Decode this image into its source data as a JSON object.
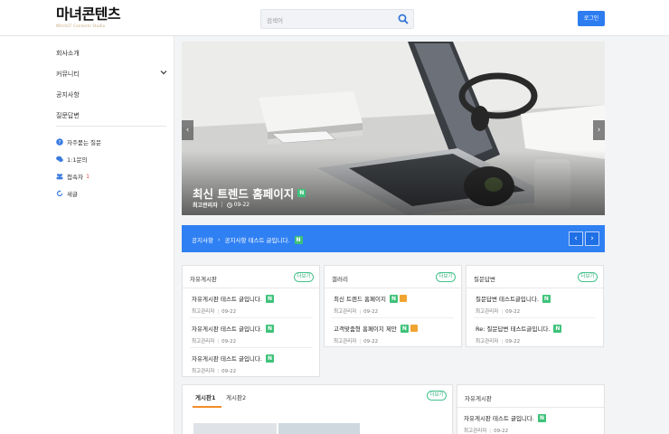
{
  "header": {
    "logo_title": "마녀콘텐츠",
    "logo_subtitle": "WitchCF Contents Studio",
    "search_placeholder": "검색어",
    "login_label": "로그인"
  },
  "sidebar": {
    "menu": [
      "회사소개",
      "커뮤니티",
      "공지사항",
      "질문답변"
    ],
    "sub": [
      {
        "label": "자주묻는 질문",
        "icon": "question-circle-icon"
      },
      {
        "label": "1:1문의",
        "icon": "chat-bubbles-icon"
      },
      {
        "label": "접속자",
        "count": "1",
        "icon": "users-icon"
      },
      {
        "label": "새글",
        "icon": "refresh-icon"
      }
    ]
  },
  "slider": {
    "title": "최신 트렌드 홈페이지",
    "author": "최고관리자",
    "date": "09-22",
    "prev": "‹",
    "next": "›"
  },
  "notice": {
    "label": "공지사항",
    "separator": "›",
    "text": "공지사항 테스트 글입니다."
  },
  "badge_new": "N",
  "more_label": "더보기",
  "boards": [
    {
      "title": "자유게시판",
      "posts": [
        {
          "title": "자유게시판 테스트 글입니다.",
          "author": "최고관리자",
          "date": "09-22"
        },
        {
          "title": "자유게시판 테스트 글입니다.",
          "author": "최고관리자",
          "date": "09-22"
        },
        {
          "title": "자유게시판 테스트 글입니다.",
          "author": "최고관리자",
          "date": "09-22"
        }
      ]
    },
    {
      "title": "갤러리",
      "posts": [
        {
          "title": "최신 트렌드 홈페이지",
          "author": "최고관리자",
          "date": "09-22",
          "has_image": true
        },
        {
          "title": "고객맞춤형 홈페이지 제안",
          "author": "최고관리자",
          "date": "09-22",
          "has_image": true
        }
      ]
    },
    {
      "title": "질문답변",
      "posts": [
        {
          "title": "질문답변 테스트글입니다.",
          "author": "최고관리자",
          "date": "09-22"
        },
        {
          "title": "Re: 질문답변 테스트글입니다.",
          "author": "최고관리자",
          "date": "09-22"
        }
      ]
    }
  ],
  "tabs_box": {
    "tabs": [
      "게시판1",
      "게시판2"
    ],
    "active_tab": 0
  },
  "bottom_board": {
    "title": "자유게시판",
    "posts": [
      {
        "title": "자유게시판 테스트 글입니다.",
        "author": "최고관리자",
        "date": "09-22"
      }
    ]
  },
  "colors": {
    "accent": "#2f80f3",
    "new_badge": "#3ec27a",
    "image_badge": "#f0a431",
    "tab_underline": "#f28c28"
  }
}
